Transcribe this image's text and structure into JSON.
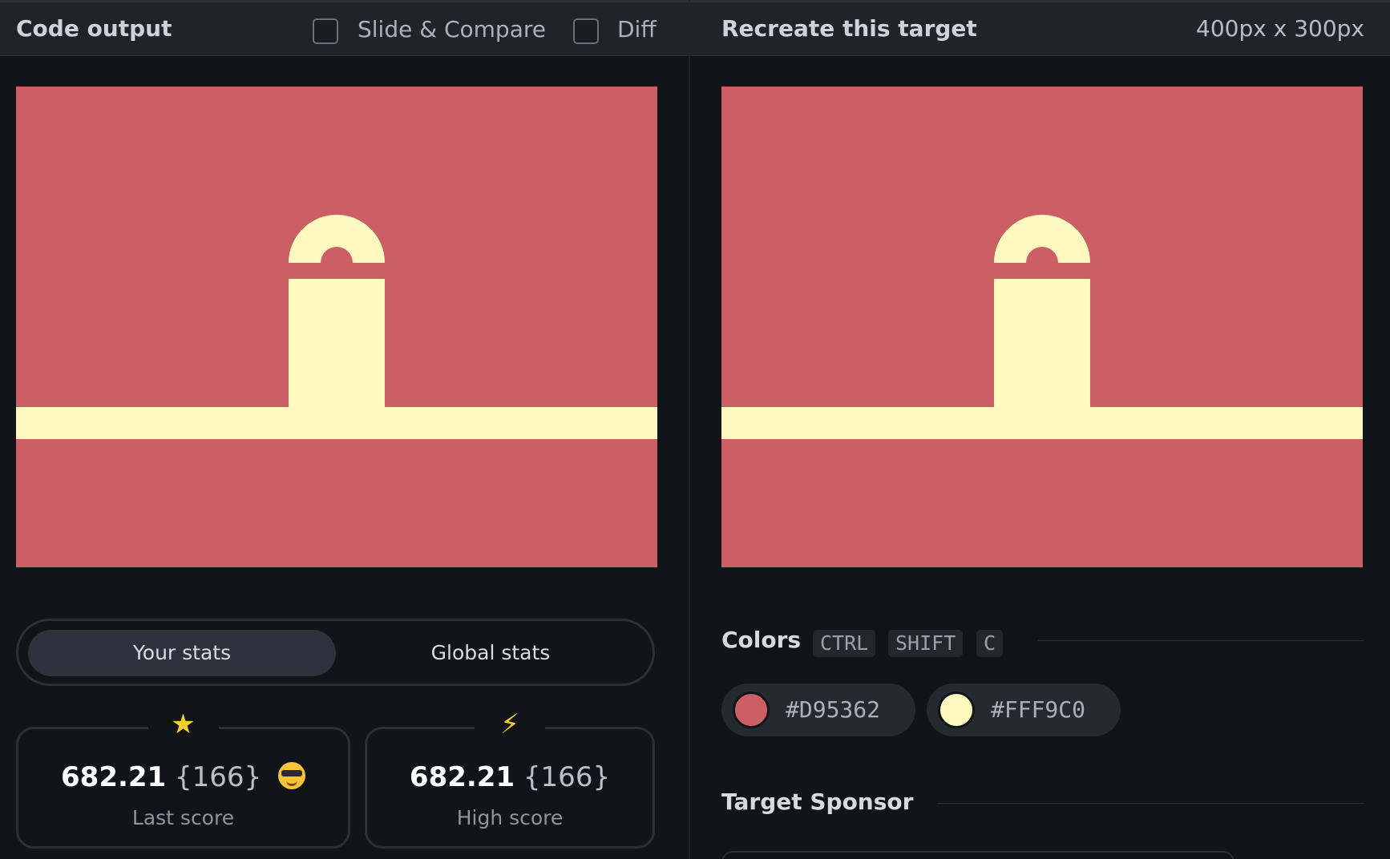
{
  "left": {
    "title": "Code output",
    "checkboxes": [
      {
        "label": "Slide & Compare",
        "checked": false
      },
      {
        "label": "Diff",
        "checked": false
      }
    ],
    "tabs": {
      "active": "Your stats",
      "inactive": "Global stats"
    },
    "stats": [
      {
        "value": "682.21",
        "count": "{166}",
        "label": "Last score",
        "icon": "star-icon"
      },
      {
        "value": "682.21",
        "count": "{166}",
        "label": "High score",
        "icon": "lightning-icon"
      }
    ]
  },
  "right": {
    "title": "Recreate this target",
    "size": "400px x 300px",
    "colors_heading": "Colors",
    "shortcut": [
      "CTRL",
      "SHIFT",
      "C"
    ],
    "colors": [
      {
        "hex": "#D95362"
      },
      {
        "hex": "#FFF9C0"
      }
    ],
    "sponsor_heading": "Target Sponsor"
  },
  "palette": {
    "background": "#cc5f66",
    "shape": "#fff9c0",
    "accent_star": "#f4cf2e"
  }
}
